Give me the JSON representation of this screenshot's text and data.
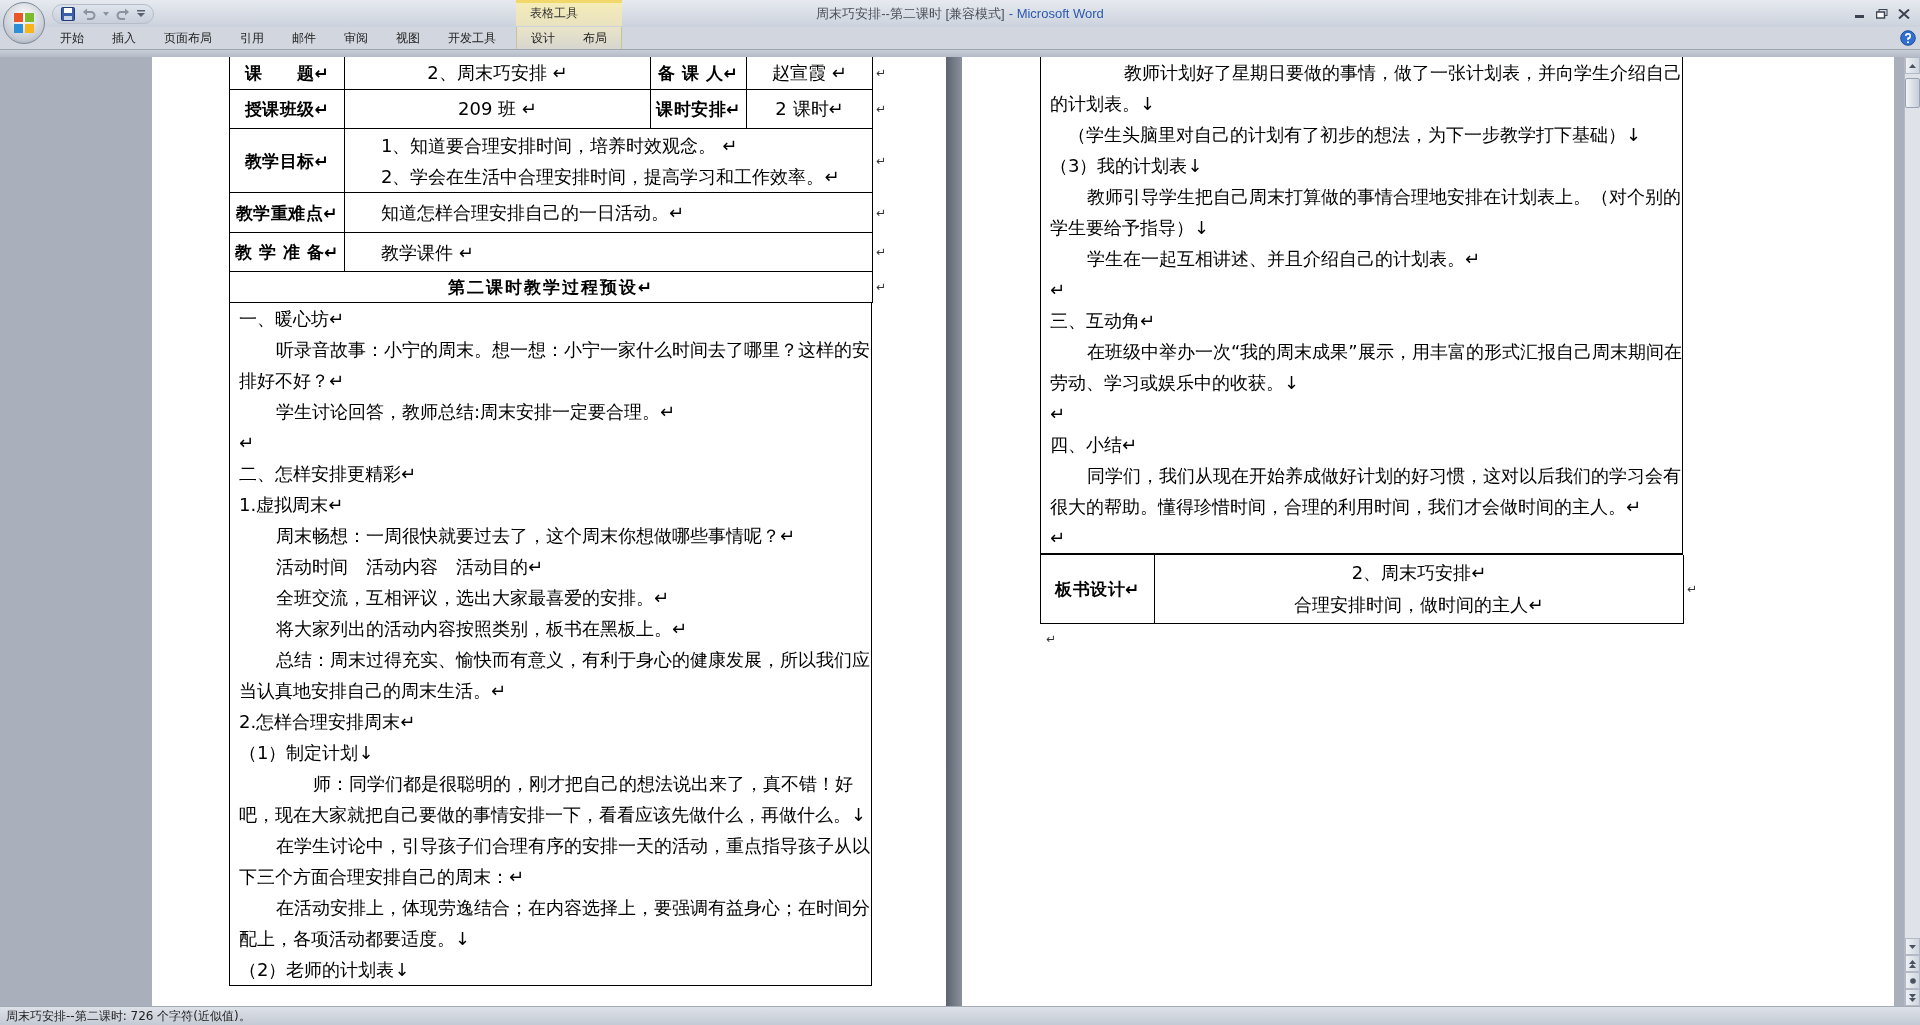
{
  "window": {
    "document_title": "周末巧安排--第二课时 [兼容模式]",
    "app_name": "- Microsoft Word"
  },
  "tabs": [
    {
      "label": "开始",
      "selected": false
    },
    {
      "label": "插入",
      "selected": false
    },
    {
      "label": "页面布局",
      "selected": false
    },
    {
      "label": "引用",
      "selected": false
    },
    {
      "label": "邮件",
      "selected": false
    },
    {
      "label": "审阅",
      "selected": false
    },
    {
      "label": "视图",
      "selected": false
    },
    {
      "label": "开发工具",
      "selected": false
    }
  ],
  "contextual_group": {
    "label": "表格工具",
    "tabs": [
      {
        "label": "设计",
        "selected": false
      },
      {
        "label": "布局",
        "selected": false
      }
    ]
  },
  "left_page": {
    "info_rows": [
      {
        "cells": [
          {
            "kind": "label",
            "text": "课　　题↵"
          },
          {
            "kind": "value",
            "text": "2、周末巧安排 ↵"
          },
          {
            "kind": "label",
            "text": "备 课 人↵"
          },
          {
            "kind": "value",
            "text": "赵宣霞 ↵"
          }
        ],
        "row_mark": "↵"
      },
      {
        "cells": [
          {
            "kind": "label",
            "text": "授课班级↵"
          },
          {
            "kind": "value",
            "text": "209 班 ↵"
          },
          {
            "kind": "label",
            "text": "课时安排↵"
          },
          {
            "kind": "value",
            "text": "2 课时↵"
          }
        ],
        "row_mark": "↵"
      },
      {
        "cells": [
          {
            "kind": "label",
            "text": "教学目标↵"
          },
          {
            "kind": "wide",
            "lines": [
              "1、知道要合理安排时间，培养时效观念。 ↵",
              "2、学会在生活中合理安排时间，提高学习和工作效率。↵"
            ]
          }
        ],
        "row_mark": "↵"
      },
      {
        "cells": [
          {
            "kind": "label",
            "text": "教学重难点↵"
          },
          {
            "kind": "wide",
            "lines": [
              "知道怎样合理安排自己的一日活动。↵"
            ]
          }
        ],
        "row_mark": "↵"
      },
      {
        "cells": [
          {
            "kind": "label",
            "text": "教 学 准 备↵"
          },
          {
            "kind": "wide",
            "lines": [
              "教学课件 ↵"
            ]
          }
        ],
        "row_mark": "↵"
      },
      {
        "cells": [
          {
            "kind": "title",
            "text": "第二课时教学过程预设↵"
          }
        ],
        "row_mark": "↵"
      }
    ],
    "process_paragraphs": [
      {
        "kind": "plain",
        "text": "一、暖心坊↵"
      },
      {
        "kind": "indented",
        "text": "听录音故事：小宁的周末。想一想：小宁一家什么时间去了哪里？这样的安排好不好？↵"
      },
      {
        "kind": "indented",
        "text": "学生讨论回答，教师总结:周末安排一定要合理。↵"
      },
      {
        "kind": "plain",
        "text": "↵"
      },
      {
        "kind": "plain",
        "text": "二、怎样安排更精彩↵"
      },
      {
        "kind": "plain",
        "text": "1.虚拟周末↵"
      },
      {
        "kind": "indented",
        "text": "周末畅想：一周很快就要过去了，这个周末你想做哪些事情呢？↵"
      },
      {
        "kind": "indented",
        "text": "活动时间　活动内容　活动目的↵"
      },
      {
        "kind": "indented",
        "text": "全班交流，互相评议，选出大家最喜爱的安排。↵"
      },
      {
        "kind": "indented",
        "text": "将大家列出的活动内容按照类别，板书在黑板上。↵"
      },
      {
        "kind": "indented",
        "text": "总结：周末过得充实、愉快而有意义，有利于身心的健康发展，所以我们应当认真地安排自己的周末生活。↵"
      },
      {
        "kind": "plain",
        "text": "2.怎样合理安排周末↵"
      },
      {
        "kind": "plain",
        "text": "（1）制定计划↓"
      },
      {
        "kind": "deep_indented",
        "text": "师：同学们都是很聪明的，刚才把自己的想法说出来了，真不错！好吧，现在大家就把自己要做的事情安排一下，看看应该先做什么，再做什么。↓"
      },
      {
        "kind": "indented",
        "text": "在学生讨论中，引导孩子们合理有序的安排一天的活动，重点指导孩子从以下三个方面合理安排自己的周末：↵"
      },
      {
        "kind": "indented",
        "text": "在活动安排上，体现劳逸结合；在内容选择上，要强调有益身心；在时间分配上，各项活动都要适度。↓"
      },
      {
        "kind": "plain",
        "text": "（2）老师的计划表↓"
      }
    ]
  },
  "right_page": {
    "process_paragraphs": [
      {
        "kind": "deep_indented",
        "text": "教师计划好了星期日要做的事情，做了一张计划表，并向学生介绍自己的计划表。↓"
      },
      {
        "kind": "half_indented",
        "text": "（学生头脑里对自己的计划有了初步的想法，为下一步教学打下基础）↓"
      },
      {
        "kind": "plain",
        "text": "（3）我的计划表↓"
      },
      {
        "kind": "indented",
        "text": "教师引导学生把自己周末打算做的事情合理地安排在计划表上。（对个别的学生要给予指导）↓"
      },
      {
        "kind": "indented",
        "text": "学生在一起互相讲述、并且介绍自己的计划表。↵"
      },
      {
        "kind": "plain",
        "text": "↵"
      },
      {
        "kind": "plain",
        "text": "三、互动角↵"
      },
      {
        "kind": "indented",
        "text": "在班级中举办一次“我的周末成果”展示，用丰富的形式汇报自己周末期间在劳动、学习或娱乐中的收获。↓"
      },
      {
        "kind": "plain",
        "text": "↵"
      },
      {
        "kind": "plain",
        "text": "四、小结↵"
      },
      {
        "kind": "indented",
        "text": "同学们，我们从现在开始养成做好计划的好习惯，这对以后我们的学习会有很大的帮助。懂得珍惜时间，合理的利用时间，我们才会做时间的主人。↵"
      },
      {
        "kind": "plain",
        "text": "↵"
      }
    ],
    "board_row": {
      "label": "板书设计↵",
      "lines": [
        "2、周末巧安排↵",
        "合理安排时间，做时间的主人↵"
      ],
      "row_mark": "↵"
    },
    "after_table_mark": "↵"
  },
  "status_bar": {
    "text": "周末巧安排--第二课时: 726 个字符(近似值)。"
  }
}
